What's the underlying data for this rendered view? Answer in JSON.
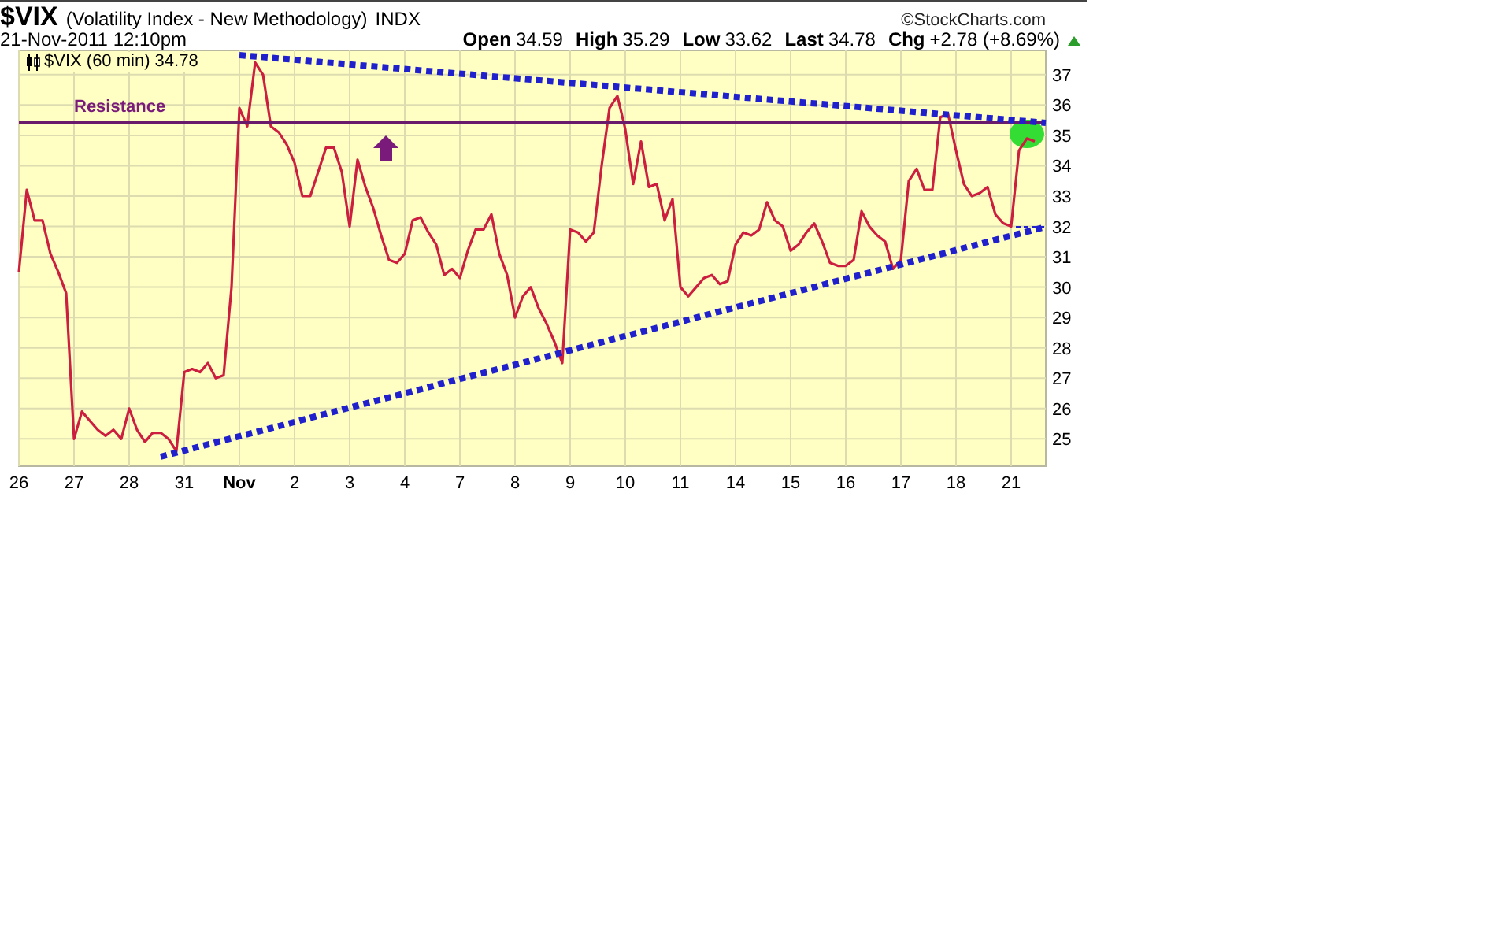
{
  "header": {
    "symbol": "$VIX",
    "name": "(Volatility Index - New Methodology)",
    "exchange": "INDX",
    "timestamp": "21-Nov-2011 12:10pm",
    "source": "©StockCharts.com",
    "quote": [
      {
        "label": "Open",
        "value": "34.59"
      },
      {
        "label": "High",
        "value": "35.29"
      },
      {
        "label": "Low",
        "value": "33.62"
      },
      {
        "label": "Last",
        "value": "34.78"
      },
      {
        "label": "Chg",
        "value": "+2.78 (+8.69%)"
      }
    ]
  },
  "chart": {
    "legend_value": "34.78",
    "resistance_label": "Resistance",
    "chart_data": {
      "type": "line",
      "grid": true,
      "ylim": [
        24.1,
        37.8
      ],
      "yticks": [
        25,
        26,
        27,
        28,
        29,
        30,
        31,
        32,
        33,
        34,
        35,
        36,
        37
      ],
      "categories": [
        "26",
        null,
        null,
        null,
        null,
        null,
        null,
        "27",
        null,
        null,
        null,
        null,
        null,
        null,
        "28",
        null,
        null,
        null,
        null,
        null,
        null,
        "31",
        null,
        null,
        null,
        null,
        null,
        null,
        "Nov",
        null,
        null,
        null,
        null,
        null,
        null,
        "2",
        null,
        null,
        null,
        null,
        null,
        null,
        "3",
        null,
        null,
        null,
        null,
        null,
        null,
        "4",
        null,
        null,
        null,
        null,
        null,
        null,
        "7",
        null,
        null,
        null,
        null,
        null,
        null,
        "8",
        null,
        null,
        null,
        null,
        null,
        null,
        "9",
        null,
        null,
        null,
        null,
        null,
        null,
        "10",
        null,
        null,
        null,
        null,
        null,
        null,
        "11",
        null,
        null,
        null,
        null,
        null,
        null,
        "14",
        null,
        null,
        null,
        null,
        null,
        null,
        "15",
        null,
        null,
        null,
        null,
        null,
        null,
        "16",
        null,
        null,
        null,
        null,
        null,
        null,
        "17",
        null,
        null,
        null,
        null,
        null,
        null,
        "18",
        null,
        null,
        null,
        null,
        null,
        null,
        "21",
        null,
        null,
        null
      ],
      "series": [
        {
          "name": "$VIX (60 min)",
          "color": "#cc1f40",
          "values": [
            30.5,
            33.2,
            32.2,
            32.2,
            31.1,
            30.5,
            29.8,
            25.0,
            25.9,
            25.6,
            25.3,
            25.1,
            25.3,
            25.0,
            26.0,
            25.3,
            24.9,
            25.2,
            25.2,
            25.0,
            24.6,
            27.2,
            27.3,
            27.2,
            27.5,
            27.0,
            27.1,
            30.0,
            35.9,
            35.3,
            37.4,
            37.0,
            35.3,
            35.1,
            34.7,
            34.1,
            33.0,
            33.0,
            33.8,
            34.6,
            34.6,
            33.8,
            32.0,
            34.2,
            33.3,
            32.6,
            31.7,
            30.9,
            30.8,
            31.1,
            32.2,
            32.3,
            31.8,
            31.4,
            30.4,
            30.6,
            30.3,
            31.2,
            31.9,
            31.9,
            32.4,
            31.1,
            30.4,
            29.0,
            29.7,
            30.0,
            29.3,
            28.8,
            28.2,
            27.5,
            31.9,
            31.8,
            31.5,
            31.8,
            34.0,
            35.9,
            36.3,
            35.2,
            33.4,
            34.8,
            33.3,
            33.4,
            32.2,
            32.9,
            30.0,
            29.7,
            30.0,
            30.3,
            30.4,
            30.1,
            30.2,
            31.4,
            31.8,
            31.7,
            31.9,
            32.8,
            32.2,
            32.0,
            31.2,
            31.4,
            31.8,
            32.1,
            31.5,
            30.8,
            30.7,
            30.7,
            30.9,
            32.5,
            32.0,
            31.7,
            31.5,
            30.6,
            30.9,
            33.5,
            33.9,
            33.2,
            33.2,
            35.6,
            35.7,
            34.5,
            33.4,
            33.0,
            33.1,
            33.3,
            32.4,
            32.1,
            32.0,
            34.5,
            34.9,
            34.8
          ]
        }
      ]
    }
  }
}
